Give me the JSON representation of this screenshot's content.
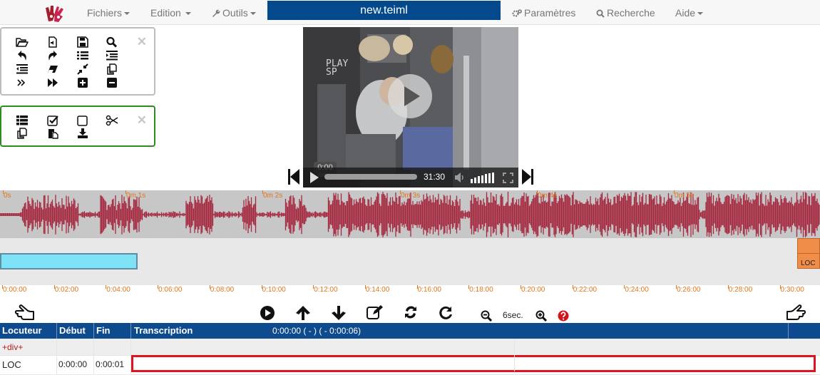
{
  "app": {
    "logo_icon": "hands-logo-icon",
    "file_name": "new.teiml"
  },
  "menu": {
    "fichiers": "Fichiers",
    "edition": "Edition",
    "outils": "Outils",
    "parametres": "Paramètres",
    "recherche": "Recherche",
    "aide": "Aide"
  },
  "toolbox_close": "✕",
  "video": {
    "osd_line1": "PLAY",
    "osd_line2": "SP",
    "current_time": "0:00",
    "duration": "31:30",
    "progress": 0
  },
  "waveform": {
    "ticks": [
      "0s",
      "0m 1s",
      "0m 2s",
      "0m 3s",
      "0m 4s",
      "0m 5s"
    ]
  },
  "segments": {
    "loc_label": "LOC"
  },
  "timeline": {
    "ticks": [
      "0:00:00",
      "0:02:00",
      "0:04:00",
      "0:06:00",
      "0:08:00",
      "0:10:00",
      "0:12:00",
      "0:14:00",
      "0:16:00",
      "0:18:00",
      "0:20:00",
      "0:22:00",
      "0:24:00",
      "0:26:00",
      "0:28:00",
      "0:30:00"
    ]
  },
  "actions": {
    "zoom_value": "6sec."
  },
  "table": {
    "headers": {
      "locuteur": "Locuteur",
      "debut": "Début",
      "fin": "Fin",
      "transcription": "Transcription"
    },
    "time_info": "0:00:00 ( - )  ( - 0:00:06)",
    "div_row_label": "+div+",
    "rows": [
      {
        "locuteur": "LOC",
        "debut": "0:00:00",
        "fin": "0:00:01",
        "transcription": ""
      }
    ]
  },
  "colors": {
    "accent_blue": "#04498c",
    "header_blue": "#0d4b8e",
    "wave_red": "#a4283f",
    "timeline_orange": "#e0761b",
    "segment_blue": "#80e2f7",
    "segment_orange": "#f08d48",
    "edit_border": "#e0141e",
    "panel_green": "#2e8b22"
  }
}
